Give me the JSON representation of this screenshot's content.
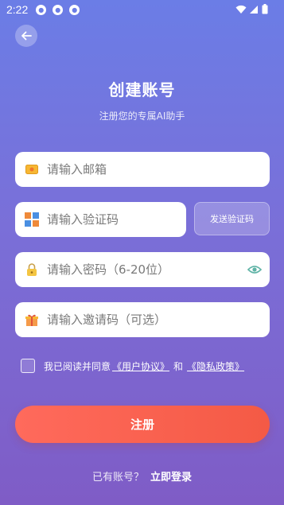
{
  "status_bar": {
    "time": "2:22",
    "icons": [
      "notification-icon",
      "notification-icon",
      "notification-icon",
      "wifi-icon",
      "signal-icon",
      "battery-icon"
    ]
  },
  "header": {
    "title": "创建账号",
    "subtitle": "注册您的专属AI助手"
  },
  "form": {
    "email": {
      "placeholder": "请输入邮箱",
      "value": ""
    },
    "code": {
      "placeholder": "请输入验证码",
      "value": "",
      "send_label": "发送验证码"
    },
    "password": {
      "placeholder": "请输入密码（6-20位）",
      "value": ""
    },
    "invite": {
      "placeholder": "请输入邀请码（可选）",
      "value": ""
    }
  },
  "agreement": {
    "prefix": "我已阅读并同意",
    "user_agreement": "《用户协议》",
    "conjunction": "和",
    "privacy_policy": "《隐私政策》",
    "checked": false
  },
  "register_label": "注册",
  "login": {
    "prompt": "已有账号？",
    "link": "立即登录"
  },
  "colors": {
    "background_top": "#6b7de6",
    "background_bottom": "#7f5cc6",
    "button": "#f45a45"
  }
}
